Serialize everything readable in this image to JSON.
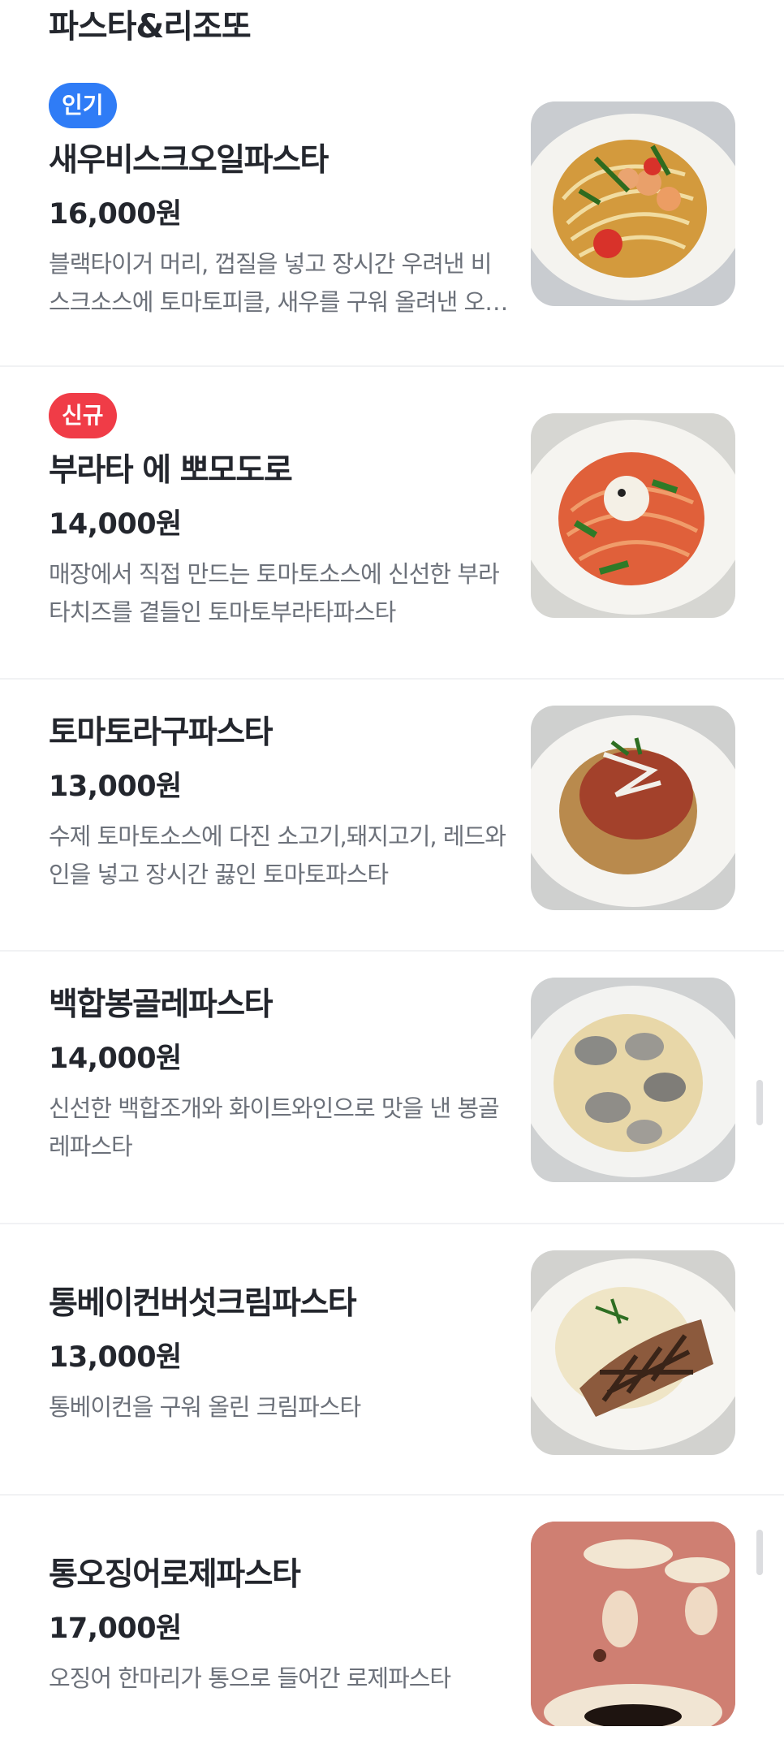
{
  "section": {
    "title": "파스타&리조또"
  },
  "menu": [
    {
      "badge": "인기",
      "badge_type": "popular",
      "name": "새우비스크오일파스타",
      "price": "16,000원",
      "description": "블랙타이거 머리, 껍질을 넣고 장시간 우려낸 비스크소스에 토마토피클, 새우를 구워 올려낸 오일파스타",
      "image_icon": "shrimp-oil-pasta-photo"
    },
    {
      "badge": "신규",
      "badge_type": "new",
      "name": "부라타 에 뽀모도로",
      "price": "14,000원",
      "description": "매장에서 직접 만드는 토마토소스에 신선한 부라타치즈를 곁들인 토마토부라타파스타",
      "image_icon": "burrata-tomato-pasta-photo"
    },
    {
      "name": "토마토라구파스타",
      "price": "13,000원",
      "description": "수제 토마토소스에 다진 소고기,돼지고기, 레드와인을 넣고 장시간 끓인 토마토파스타",
      "image_icon": "tomato-ragu-pasta-photo"
    },
    {
      "name": "백합봉골레파스타",
      "price": "14,000원",
      "description": "신선한 백합조개와 화이트와인으로 맛을 낸 봉골레파스타",
      "image_icon": "clam-vongole-pasta-photo"
    },
    {
      "name": "통베이컨버섯크림파스타",
      "price": "13,000원",
      "description": "통베이컨을 구워 올린 크림파스타",
      "image_icon": "bacon-cream-pasta-photo"
    },
    {
      "name": "통오징어로제파스타",
      "price": "17,000원",
      "description": "오징어 한마리가 통으로 들어간 로제파스타",
      "image_icon": "squid-rose-pasta-photo"
    }
  ],
  "colors": {
    "badge_popular": "#2f7cf6",
    "badge_new": "#f03c47",
    "text_primary": "#23262d",
    "text_secondary": "#6c717a"
  }
}
